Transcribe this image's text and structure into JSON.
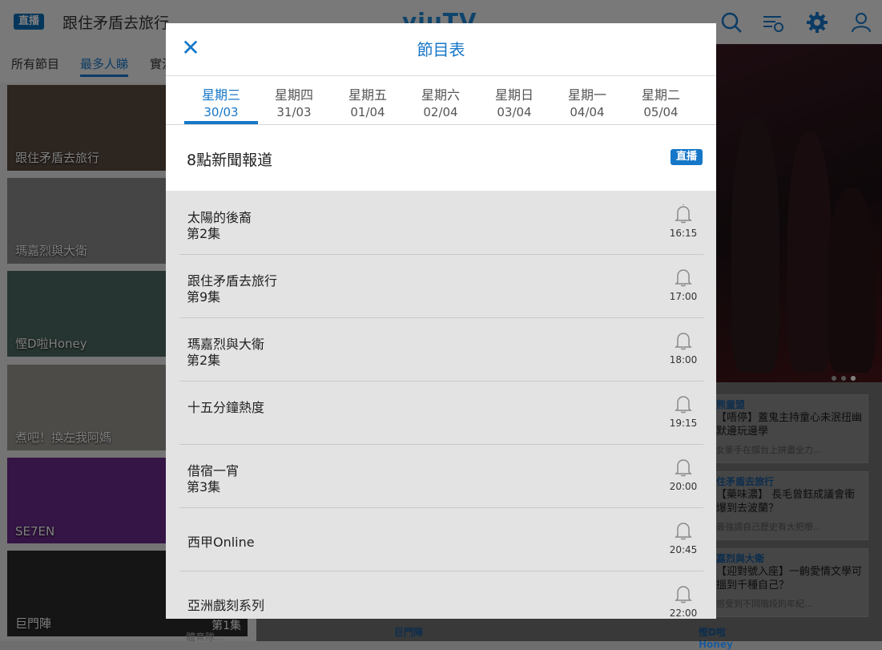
{
  "background": {
    "live_badge": "直播",
    "live_title": "跟住矛盾去旅行",
    "logo": "viuTV",
    "icons": [
      "search-icon",
      "schedule-icon",
      "gear-icon",
      "user-icon"
    ],
    "nav": [
      "所有節目",
      "最多人睇",
      "實況"
    ],
    "thumbs": [
      {
        "label": "跟住矛盾去旅行",
        "color": "#5a4a40"
      },
      {
        "label": "瑪嘉烈與大衛",
        "color": "#8a8a8a"
      },
      {
        "label": "慳D啦Honey",
        "color": "#4d6a62"
      },
      {
        "label": "煮吧！換左我阿媽",
        "color": "#9a9690"
      },
      {
        "label": "SE7EN",
        "color": "#6a2a8a"
      },
      {
        "label": "巨門陣",
        "color": "#2a2a2a",
        "episode": "第1集"
      }
    ],
    "cards": [
      {
        "category": "熊童盟",
        "title": "【唔停】蓋鬼主持童心未泯扭幽默邊玩邊學",
        "desc": "女麥手在擂台上拼盡全力..."
      },
      {
        "category": "住矛盾去旅行",
        "title": "【藥味濃】 長毛曾鈺成議會衝爆到去波蘭？",
        "desc": "最強調自己歷史有大把嘢..."
      },
      {
        "category": "嘉烈與大衛",
        "title": "【迎對號入座】一齣愛情文學可搵到千種自己？",
        "desc": "感受到不同階段的年紀..."
      }
    ],
    "bottom": {
      "left": "巨門陣",
      "right": "慳D啦Honey",
      "extra": "體育隊..."
    }
  },
  "modal": {
    "title": "節目表",
    "close_icon": "close-icon",
    "days": [
      {
        "name": "星期三",
        "date": "30/03",
        "active": true
      },
      {
        "name": "星期四",
        "date": "31/03"
      },
      {
        "name": "星期五",
        "date": "01/04"
      },
      {
        "name": "星期六",
        "date": "02/04"
      },
      {
        "name": "星期日",
        "date": "03/04"
      },
      {
        "name": "星期一",
        "date": "04/04"
      },
      {
        "name": "星期二",
        "date": "05/04"
      }
    ],
    "now_playing": {
      "title": "8點新聞報道",
      "badge": "直播"
    },
    "schedule": [
      {
        "title": "太陽的後裔",
        "episode": "第2集",
        "time": "16:15"
      },
      {
        "title": "跟住矛盾去旅行",
        "episode": "第9集",
        "time": "17:00"
      },
      {
        "title": "瑪嘉烈與大衛",
        "episode": "第2集",
        "time": "18:00"
      },
      {
        "title": "十五分鐘熱度",
        "episode": "",
        "time": "19:15"
      },
      {
        "title": "借宿一宵",
        "episode": "第3集",
        "time": "20:00"
      },
      {
        "title": "西甲Online",
        "episode": "",
        "time": "20:45"
      },
      {
        "title": "亞洲戲刻系列",
        "episode": "",
        "time": "22:00"
      }
    ]
  }
}
